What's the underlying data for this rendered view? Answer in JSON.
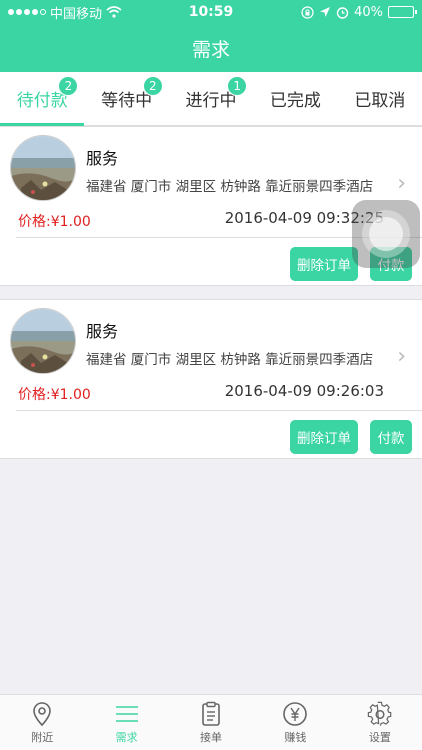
{
  "status_bar": {
    "carrier": "中国移动",
    "time": "10:59",
    "battery": "40%",
    "battery_level": 0.4,
    "icons": [
      "signal-icon",
      "wifi-icon",
      "lock-rotation-icon",
      "location-icon",
      "alarm-icon",
      "battery-icon"
    ]
  },
  "navbar": {
    "title": "需求"
  },
  "tabs": [
    {
      "label": "待付款",
      "badge": "2",
      "active": true
    },
    {
      "label": "等待中",
      "badge": "2",
      "active": false
    },
    {
      "label": "进行中",
      "badge": "1",
      "active": false
    },
    {
      "label": "已完成",
      "badge": "",
      "active": false
    },
    {
      "label": "已取消",
      "badge": "",
      "active": false
    }
  ],
  "orders": [
    {
      "title": "服务",
      "address": "福建省 厦门市 湖里区 枋钟路 靠近丽景四季酒店",
      "price": "价格:¥1.00",
      "time": "2016-04-09 09:32:25",
      "delete_label": "删除订单",
      "pay_label": "付款"
    },
    {
      "title": "服务",
      "address": "福建省 厦门市 湖里区 枋钟路 靠近丽景四季酒店",
      "price": "价格:¥1.00",
      "time": "2016-04-09 09:26:03",
      "delete_label": "删除订单",
      "pay_label": "付款"
    }
  ],
  "tabbar": [
    {
      "label": "附近",
      "icon": "location-pin-icon",
      "active": false
    },
    {
      "label": "需求",
      "icon": "list-icon",
      "active": true
    },
    {
      "label": "接单",
      "icon": "clipboard-icon",
      "active": false
    },
    {
      "label": "赚钱",
      "icon": "yen-icon",
      "active": false
    },
    {
      "label": "设置",
      "icon": "gear-icon",
      "active": false
    }
  ],
  "colors": {
    "accent": "#3bd5a3",
    "price": "#e02020"
  }
}
